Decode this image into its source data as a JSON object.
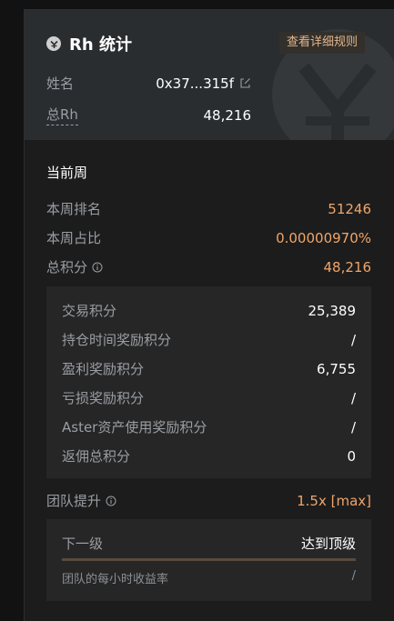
{
  "header": {
    "title": "Rh 统计",
    "rules_button": "查看详细规则",
    "name_label": "姓名",
    "name_value": "0x37...315f",
    "total_label": "总Rh",
    "total_value": "48,216",
    "logo_icon": "aster-logo-icon",
    "accent_color": "#f0a56a"
  },
  "week": {
    "section_title": "当前周",
    "rank_label": "本周排名",
    "rank_value": "51246",
    "share_label": "本周占比",
    "share_value": "0.00000970%",
    "points_label": "总积分",
    "points_value": "48,216"
  },
  "breakdown": [
    {
      "label": "交易积分",
      "value": "25,389"
    },
    {
      "label": "持仓时间奖励积分",
      "value": "/"
    },
    {
      "label": "盈利奖励积分",
      "value": "6,755"
    },
    {
      "label": "亏损奖励积分",
      "value": "/"
    },
    {
      "label": "Aster资产使用奖励积分",
      "value": "/"
    },
    {
      "label": "返佣总积分",
      "value": "0"
    }
  ],
  "team": {
    "boost_label": "团队提升",
    "boost_value": "1.5x [max]",
    "next_level_label": "下一级",
    "next_level_value": "达到顶级",
    "progress": 1.0,
    "hourly_label": "团队的每小时收益率",
    "hourly_value": "/"
  }
}
